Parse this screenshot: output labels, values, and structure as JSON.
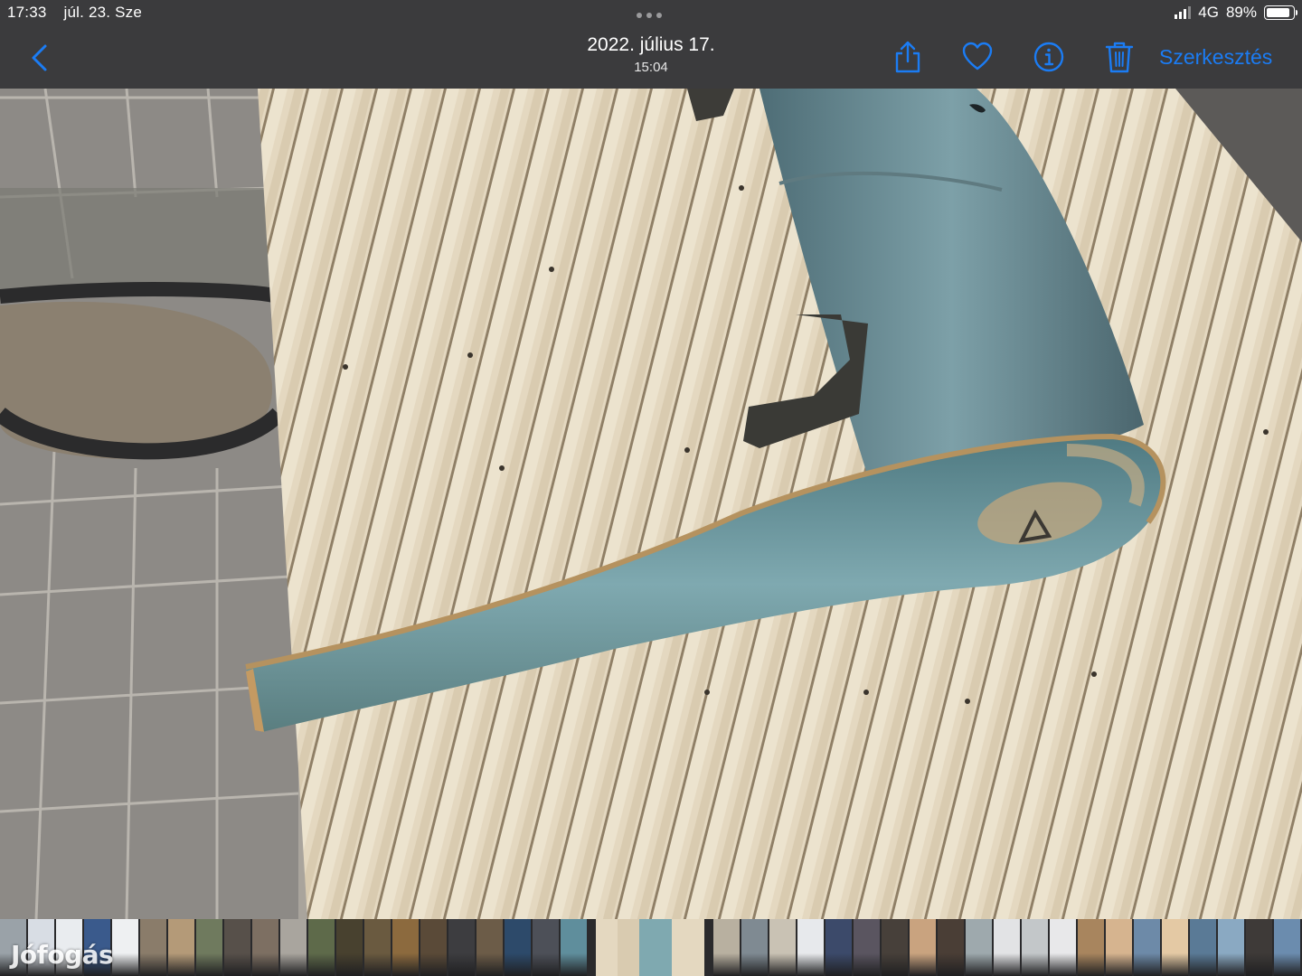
{
  "status_bar": {
    "time": "17:33",
    "date": "júl. 23. Sze",
    "network": "4G",
    "battery": "89%",
    "battery_level": 0.89
  },
  "nav": {
    "back_icon": "chevron-left-icon",
    "title_date": "2022. július 17.",
    "title_time": "15:04",
    "edit_label": "Szerkesztés",
    "accent_color": "#1b7cf4",
    "tools": [
      "share-icon",
      "heart-icon",
      "info-icon",
      "trash-icon"
    ]
  },
  "watermark": "Jófogás",
  "filmstrip": {
    "thumb_colors": [
      "#9aa2a8",
      "#d8dde4",
      "#e9ecef",
      "#3a5a8c",
      "#eef0f2",
      "#8a7c6a",
      "#b49a78",
      "#6f7a5e",
      "#57504a",
      "#7d6f62",
      "#a9a59e",
      "#5e6a4a",
      "#48412f",
      "#6a5a40",
      "#8c6a3e",
      "#5a4a38",
      "#3d3d40",
      "#6c5c48",
      "#2d4a6a",
      "#4d5058",
      "#5f8e9c",
      "#d8c9a4",
      "#b8b0a0",
      "#7f8a92",
      "#c9c2b4",
      "#e7e9ec",
      "#3c4a6a",
      "#5a5560",
      "#47403a",
      "#c9a37f",
      "#4a3e36",
      "#9ea9ad",
      "#e2e3e5",
      "#c3c7c9",
      "#e8e8ea",
      "#a8855e",
      "#d6b48f",
      "#6d8aa8",
      "#e4c9a4",
      "#5a7a96",
      "#8aa9c2",
      "#3e3a38",
      "#6b8cae"
    ],
    "current_index": 21
  }
}
